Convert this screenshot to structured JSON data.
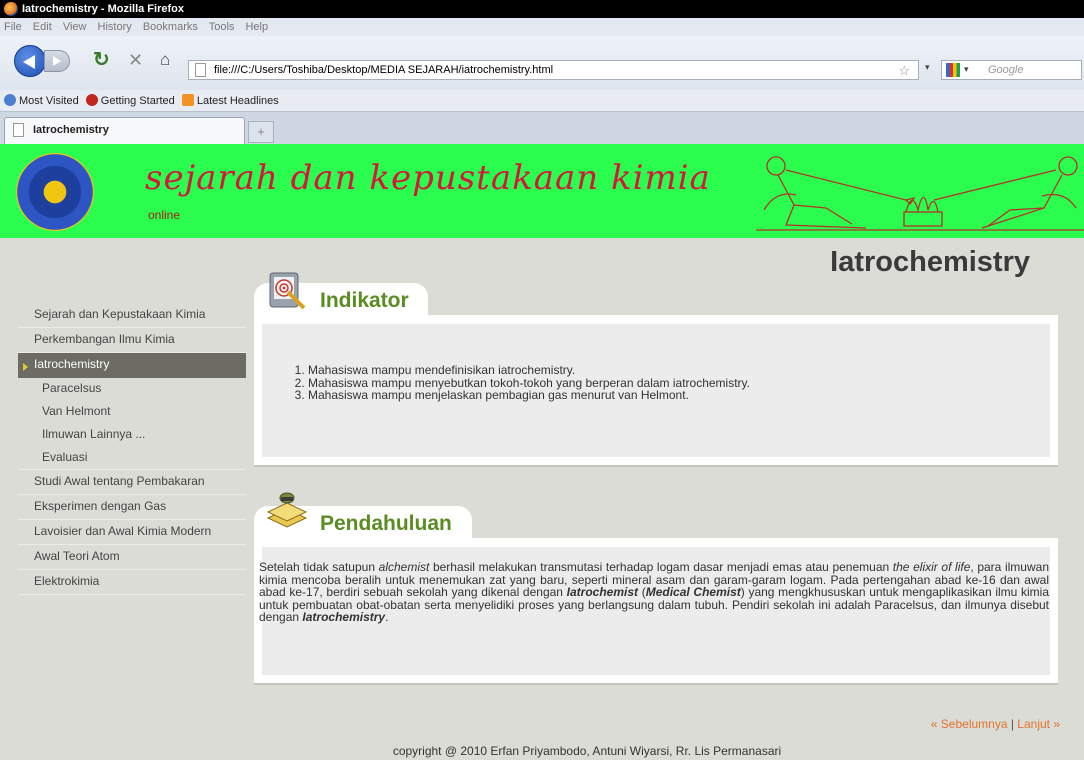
{
  "window": {
    "title": "Iatrochemistry - Mozilla Firefox"
  },
  "menubar": [
    "File",
    "Edit",
    "View",
    "History",
    "Bookmarks",
    "Tools",
    "Help"
  ],
  "navbar": {
    "url": "file:///C:/Users/Toshiba/Desktop/MEDIA SEJARAH/iatrochemistry.html",
    "search_placeholder": "Google"
  },
  "bookmarks": [
    "Most Visited",
    "Getting Started",
    "Latest Headlines"
  ],
  "tab": {
    "title": "Iatrochemistry",
    "new_tab": "+"
  },
  "header": {
    "title": "sejarah dan kepustakaan kimia",
    "subtitle": "online"
  },
  "page": {
    "heading": "Iatrochemistry"
  },
  "sidebar": {
    "items": [
      {
        "label": "Sejarah dan Kepustakaan Kimia",
        "type": "main"
      },
      {
        "label": "Perkembangan Ilmu Kimia",
        "type": "main"
      },
      {
        "label": "Iatrochemistry",
        "type": "active"
      },
      {
        "label": "Paracelsus",
        "type": "sub"
      },
      {
        "label": "Van Helmont",
        "type": "sub"
      },
      {
        "label": "Ilmuwan Lainnya ...",
        "type": "sub"
      },
      {
        "label": "Evaluasi",
        "type": "sub"
      },
      {
        "label": "Studi Awal tentang Pembakaran",
        "type": "main"
      },
      {
        "label": "Eksperimen dengan Gas",
        "type": "main"
      },
      {
        "label": "Lavoisier dan Awal Kimia Modern",
        "type": "main"
      },
      {
        "label": "Awal Teori Atom",
        "type": "main"
      },
      {
        "label": "Elektrokimia",
        "type": "main"
      }
    ]
  },
  "indikator": {
    "title": "Indikator",
    "items": [
      "Mahasiswa mampu mendefinisikan iatrochemistry.",
      "Mahasiswa mampu menyebutkan tokoh-tokoh yang berperan dalam iatrochemistry.",
      "Mahasiswa mampu menjelaskan pembagian gas menurut van Helmont."
    ]
  },
  "pendahuluan": {
    "title": "Pendahuluan",
    "t1": "Setelah tidak satupun ",
    "t2": "alchemist",
    "t3": " berhasil melakukan transmutasi terhadap logam dasar menjadi emas atau penemuan ",
    "t4": "the elixir of life",
    "t5": ", para ilmuwan kimia mencoba beralih untuk menemukan zat yang baru, seperti mineral asam dan garam-garam logam. Pada pertengahan abad ke-16 dan awal abad ke-17, berdiri sebuah sekolah yang dikenal dengan ",
    "t6": "Iatrochemist",
    "t7": " (",
    "t8": "Medical Chemist",
    "t9": ") yang mengkhususkan untuk mengaplikasikan ilmu kimia untuk pembuatan obat-obatan serta menyelidiki proses yang berlangsung dalam tubuh. Pendiri sekolah ini adalah Paracelsus, dan ilmunya disebut dengan ",
    "t10": "Iatrochemistry",
    "t11": "."
  },
  "pager": {
    "prev": "« Sebelumnya",
    "sep": " | ",
    "next": "Lanjut »"
  },
  "footer": {
    "text": "copyright @ 2010 Erfan Priyambodo, Antuni Wiyarsi, Rr. Lis Permanasari"
  },
  "colors": {
    "header_bg": "#2bfd4f",
    "title_red": "#d4173c",
    "heading_green": "#5a8c22",
    "pager_orange": "#e2722c",
    "sidebar_active": "#6c6c62"
  }
}
